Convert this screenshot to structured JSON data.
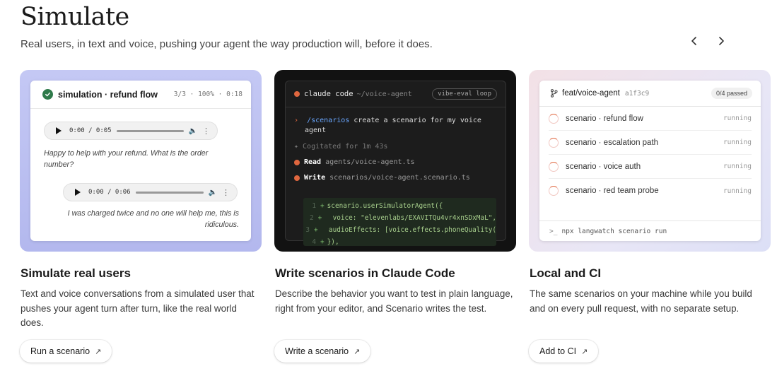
{
  "header": {
    "title": "Simulate",
    "subtitle": "Real users, in text and voice, pushing your agent the way production will, before it does.",
    "prev_icon": "chevron-left-icon",
    "next_icon": "chevron-right-icon"
  },
  "cards": [
    {
      "title": "Simulate real users",
      "description": "Text and voice conversations from a simulated user that pushes your agent turn after turn, like the real world does.",
      "button_label": "Run a scenario",
      "visual": {
        "name": "simulation · refund flow",
        "meta": "3/3 · 100% · 0:18",
        "audio1_time": "0:00 / 0:05",
        "message1": "Happy to help with your refund. What is the order number?",
        "audio2_time": "0:00 / 0:06",
        "message2": "I was charged twice and no one will help me, this is ridiculous."
      }
    },
    {
      "title": "Write scenarios in Claude Code",
      "description": "Describe the behavior you want to test in plain language, right from your editor, and Scenario writes the test.",
      "button_label": "Write a scenario",
      "visual": {
        "term_title": "claude code",
        "term_path": "~/voice-agent",
        "badge": "vibe-eval loop",
        "prompt_arrow": "›",
        "command": "/scenarios",
        "prompt_line1": "create a scenario for my voice",
        "prompt_line2": "agent",
        "thinking": "✦ Cogitated for 1m 43s",
        "read_label": "Read",
        "read_path": "agents/voice-agent.ts",
        "write_label": "Write",
        "write_path": "scenarios/voice-agent.scenario.ts",
        "code_lines": [
          {
            "n": "1",
            "mark": "+",
            "code": "scenario.userSimulatorAgent({"
          },
          {
            "n": "2",
            "mark": "+",
            "code": "  voice: \"elevenlabs/EXAVITQu4vr4xnSDxMaL\","
          },
          {
            "n": "3",
            "mark": "+",
            "code": "  audioEffects: [voice.effects.phoneQuality("
          },
          {
            "n": "4",
            "mark": "+",
            "code": "}),"
          }
        ]
      }
    },
    {
      "title": "Local and CI",
      "description": "The same scenarios on your machine while you build and on every pull request, with no separate setup.",
      "button_label": "Add to CI",
      "visual": {
        "branch": "feat/voice-agent",
        "commit": "a1f3c9",
        "passed": "0/4 passed",
        "rows": [
          {
            "label": "scenario · refund flow",
            "status": "running"
          },
          {
            "label": "scenario · escalation path",
            "status": "running"
          },
          {
            "label": "scenario · voice auth",
            "status": "running"
          },
          {
            "label": "scenario · red team probe",
            "status": "running"
          }
        ],
        "command": "npx langwatch scenario run",
        "prompt_symbol": ">_"
      }
    }
  ]
}
